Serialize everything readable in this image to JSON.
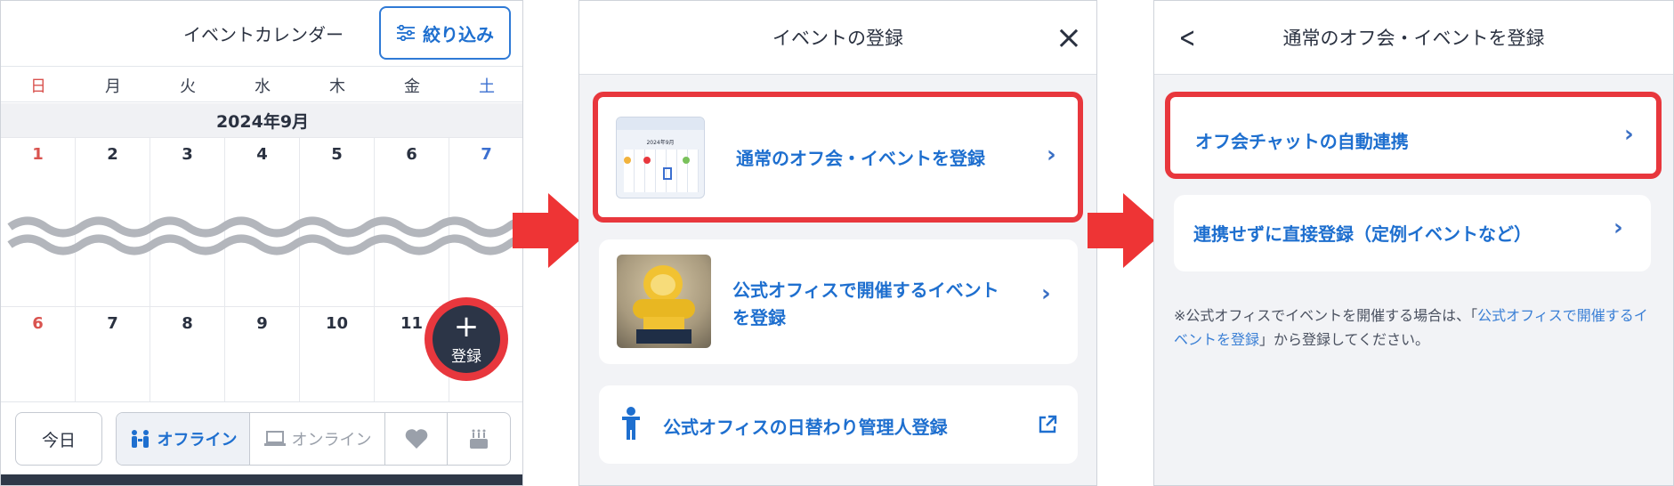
{
  "panel1": {
    "title": "イベントカレンダー",
    "filter_label": "絞り込み",
    "weekdays": [
      "日",
      "月",
      "火",
      "水",
      "木",
      "金",
      "土"
    ],
    "month_label": "2024年9月",
    "week1": [
      "1",
      "2",
      "3",
      "4",
      "5",
      "6",
      "7"
    ],
    "week2": [
      "6",
      "7",
      "8",
      "9",
      "10",
      "11"
    ],
    "fab_plus": "+",
    "fab_label": "登録",
    "today_label": "今日",
    "seg_offline": "オフライン",
    "seg_online": "オンライン"
  },
  "panel2": {
    "title": "イベントの登録",
    "close_icon": "×",
    "item1_label": "通常のオフ会・イベントを登録",
    "item1_thumb_month": "2024年9月",
    "item2_label_line1": "公式オフィスで開催するイベント",
    "item2_label_line2": "を登録",
    "item3_label": "公式オフィスの日替わり管理人登録"
  },
  "panel3": {
    "title": "通常のオフ会・イベントを登録",
    "back_icon": "<",
    "item1_label": "オフ会チャットの自動連携",
    "item2_label": "連携せずに直接登録（定例イベントなど）",
    "note_prefix": "※公式オフィスでイベントを開催する場合は、「",
    "note_link": "公式オフィスで開催するイベントを登録",
    "note_suffix": "」から登録してください。"
  },
  "colors": {
    "accent_blue": "#1e6fcf",
    "highlight_red": "#e8373d",
    "sunday_red": "#d9534f",
    "saturday_blue": "#3b6fd0",
    "dark_navy": "#2c3547"
  }
}
